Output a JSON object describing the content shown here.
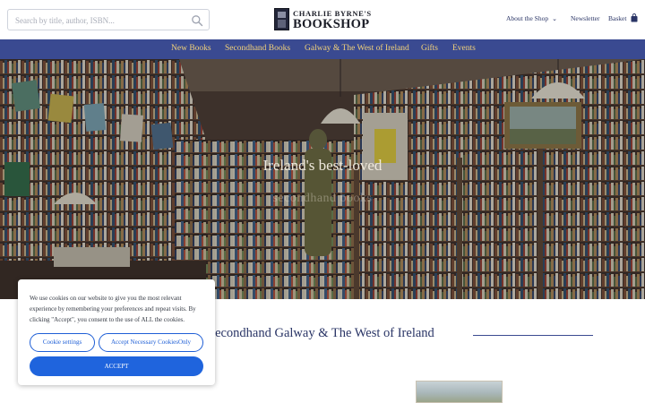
{
  "header": {
    "search": {
      "placeholder": "Search by title, author, ISBN..."
    },
    "logo": {
      "line1": "CHARLIE BYRNE'S",
      "line2": "BOOKSHOP"
    },
    "nav": {
      "about": "About the Shop",
      "newsletter": "Newsletter",
      "basket": "Basket"
    }
  },
  "category_nav": [
    {
      "label": "New Books"
    },
    {
      "label": "Secondhand Books"
    },
    {
      "label": "Galway & The West of Ireland"
    },
    {
      "label": "Gifts"
    },
    {
      "label": "Events"
    }
  ],
  "hero": {
    "title": "Ireland's best-loved",
    "subtitle": "secondhand books"
  },
  "section": {
    "heading": "Secondhand Galway & The West of Ireland"
  },
  "cookie": {
    "message": "We use cookies on our website to give you the most relevant experience by remembering your preferences and repeat visits. By clicking \"Accept\", you consent to the use of ALL the cookies.",
    "settings_label": "Cookie settings",
    "necessary_label": "Accept Necessary CookiesOnly",
    "accept_label": "ACCEPT"
  },
  "colors": {
    "nav_bar": "#3a4a91",
    "nav_text": "#f2d27a",
    "accent_blue": "#1f64dd",
    "heading_text": "#2a3566"
  },
  "icons": {
    "search": "search-icon",
    "dropdown": "chevron-down-icon",
    "basket": "basket-icon"
  }
}
